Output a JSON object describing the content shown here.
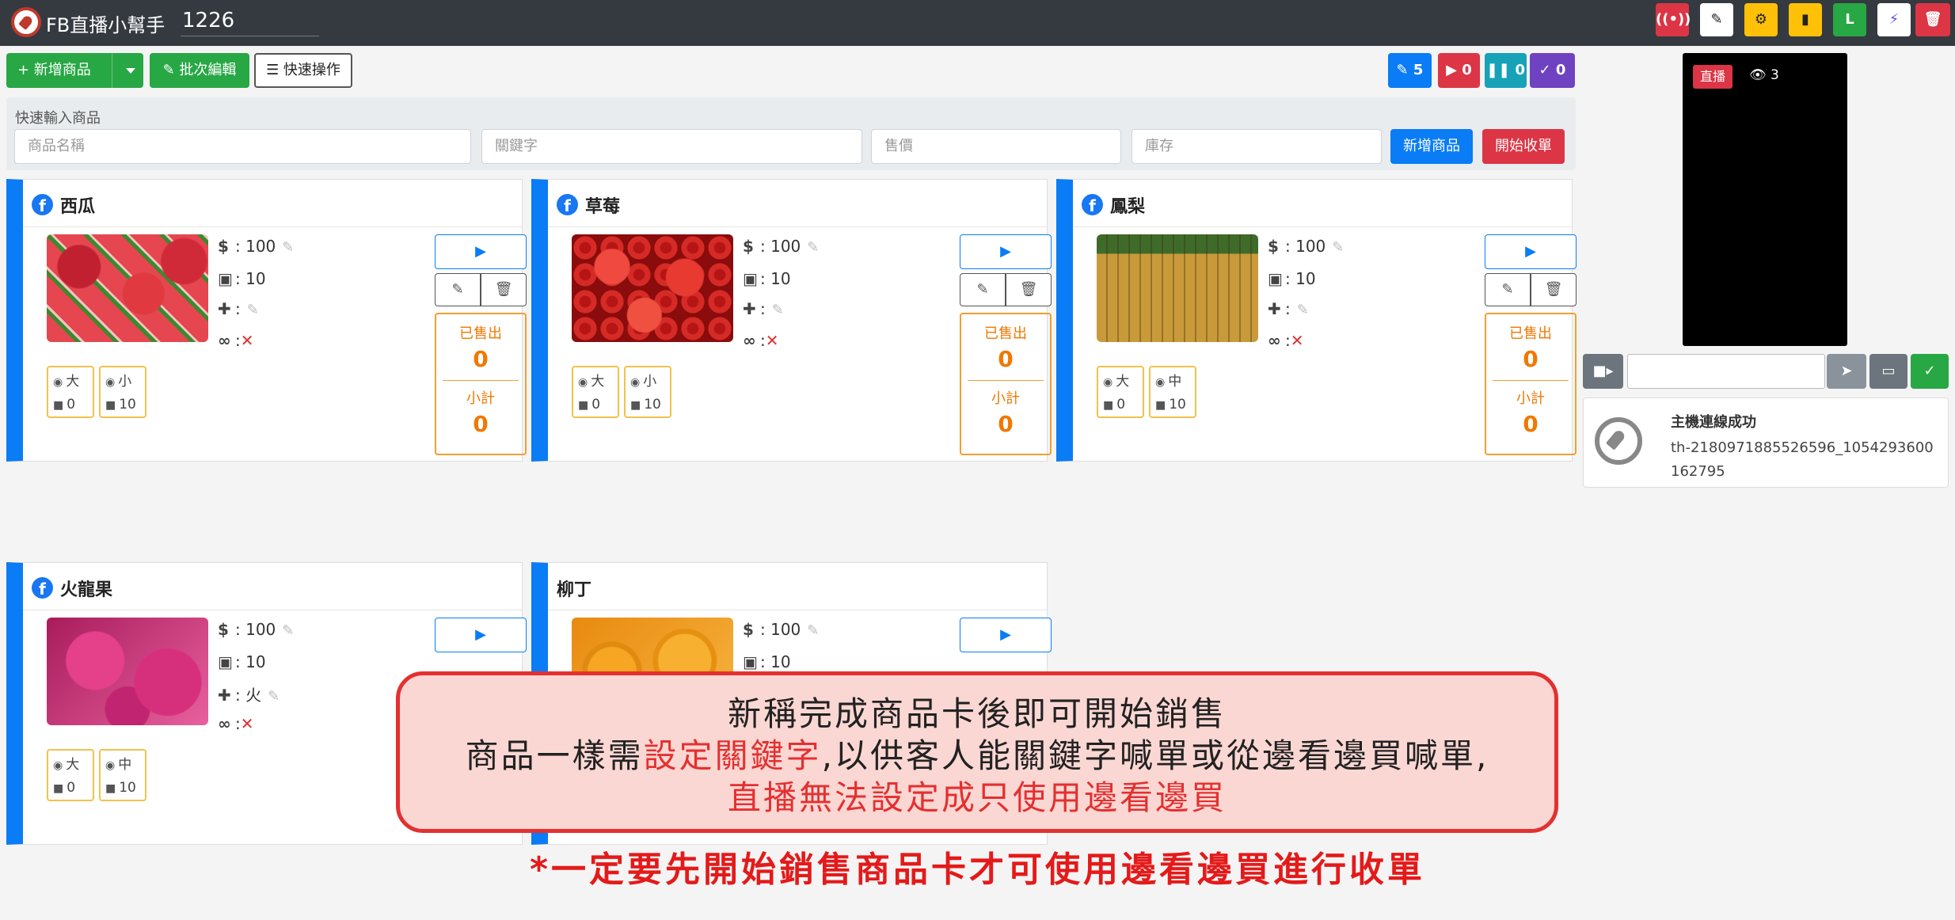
{
  "app": {
    "title": "FB直播小幫手",
    "session_id": "1226"
  },
  "nav_buttons": [
    {
      "icon": "broadcast-icon",
      "glyph": "((•))",
      "color": "#dc3545"
    },
    {
      "icon": "wrench-icon",
      "glyph": "✎",
      "color": "#ffffff"
    },
    {
      "icon": "gear-icon",
      "glyph": "⚙",
      "color": "#ffc107"
    },
    {
      "icon": "book-icon",
      "glyph": "▮",
      "color": "#ffc107"
    },
    {
      "icon": "line-icon",
      "glyph": "L",
      "color": "#28a745"
    },
    {
      "icon": "messenger-icon",
      "glyph": "⚡",
      "color": "#ffffff"
    },
    {
      "icon": "trash-icon",
      "glyph": "🗑",
      "color": "#dc3545"
    }
  ],
  "toolbar": {
    "add_product": "+ 新增商品",
    "batch_edit": "✎ 批次編輯",
    "quick_actions": "☰ 快速操作"
  },
  "counters": [
    {
      "glyph": "✎",
      "value": "5",
      "color": "#0a7cf5"
    },
    {
      "glyph": "▶",
      "value": "0",
      "color": "#dc3545"
    },
    {
      "glyph": "❚❚",
      "value": "0",
      "color": "#17a2b8"
    },
    {
      "glyph": "✓",
      "value": "0",
      "color": "#6f42c1"
    }
  ],
  "quick_input": {
    "label": "快速輸入商品",
    "name_placeholder": "商品名稱",
    "keyword_placeholder": "關鍵字",
    "price_placeholder": "售價",
    "stock_placeholder": "庫存",
    "add_button": "新增商品",
    "start_button": "開始收單"
  },
  "products": [
    {
      "name": "西瓜",
      "price": ": 100",
      "stock": ": 10",
      "keyword": ":",
      "unlimited": ":",
      "variants": [
        {
          "label": "大",
          "stock": "0"
        },
        {
          "label": "小",
          "stock": "10"
        }
      ],
      "sold_label": "已售出",
      "sold": "0",
      "subtotal_label": "小計",
      "subtotal": "0"
    },
    {
      "name": "草莓",
      "price": ": 100",
      "stock": ": 10",
      "keyword": ":",
      "unlimited": ":",
      "variants": [
        {
          "label": "大",
          "stock": "0"
        },
        {
          "label": "小",
          "stock": "10"
        }
      ],
      "sold_label": "已售出",
      "sold": "0",
      "subtotal_label": "小計",
      "subtotal": "0"
    },
    {
      "name": "鳳梨",
      "price": ": 100",
      "stock": ": 10",
      "keyword": ":",
      "unlimited": ":",
      "variants": [
        {
          "label": "大",
          "stock": "0"
        },
        {
          "label": "中",
          "stock": "10"
        }
      ],
      "sold_label": "已售出",
      "sold": "0",
      "subtotal_label": "小計",
      "subtotal": "0"
    },
    {
      "name": "火龍果",
      "price": ": 100",
      "stock": ": 10",
      "keyword": ": 火",
      "unlimited": ":",
      "variants": [
        {
          "label": "大",
          "stock": "0"
        },
        {
          "label": "中",
          "stock": "10"
        }
      ]
    },
    {
      "name": "柳丁",
      "price": ": 100",
      "stock": ": 10"
    }
  ],
  "live": {
    "badge": "直播",
    "viewers": "3"
  },
  "status": {
    "title": "主機連線成功",
    "id": "th-2180971885526596_1054293600162795"
  },
  "callout": {
    "line1": "新稱完成商品卡後即可開始銷售",
    "line2_a": "商品一樣需",
    "line2_b": "設定關鍵字",
    "line2_c": ",以供客人能關鍵字喊單或從邊看邊買喊單,",
    "line3": "直播無法設定成只使用邊看邊買"
  },
  "footnote": "*一定要先開始銷售商品卡才可使用邊看邊買進行收單"
}
